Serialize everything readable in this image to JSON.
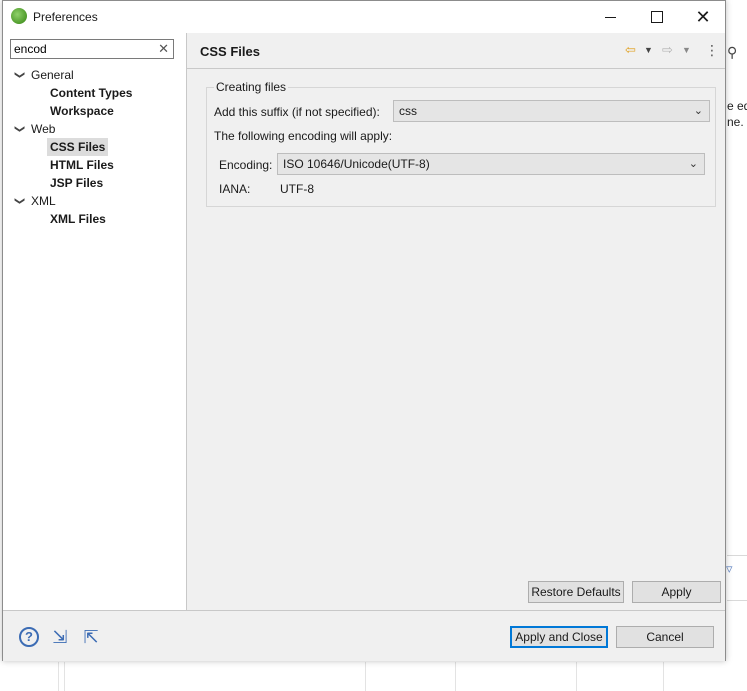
{
  "window": {
    "title": "Preferences"
  },
  "filter": {
    "value": "encod"
  },
  "tree": {
    "items": [
      {
        "label": "General",
        "kind": "group"
      },
      {
        "label": "Content Types",
        "kind": "child"
      },
      {
        "label": "Workspace",
        "kind": "child"
      },
      {
        "label": "Web",
        "kind": "group"
      },
      {
        "label": "CSS Files",
        "kind": "child",
        "selected": true
      },
      {
        "label": "HTML Files",
        "kind": "child"
      },
      {
        "label": "JSP Files",
        "kind": "child"
      },
      {
        "label": "XML",
        "kind": "group"
      },
      {
        "label": "XML Files",
        "kind": "child"
      }
    ]
  },
  "page": {
    "title": "CSS Files",
    "group_label": "Creating files",
    "suffix_label": "Add this suffix (if not specified):",
    "suffix_value": "css",
    "encoding_info": "The following encoding will apply:",
    "encoding_label": "Encoding:",
    "encoding_value": "ISO 10646/Unicode(UTF-8)",
    "iana_label": "IANA:",
    "iana_value": "UTF-8",
    "restore_defaults": "Restore Defaults",
    "apply": "Apply"
  },
  "footer": {
    "apply_and_close": "Apply and Close",
    "cancel": "Cancel"
  },
  "background": {
    "text_1": "e ed",
    "text_2": "ne."
  },
  "colors": {
    "accent": "#0078d7",
    "icon_blue": "#3c6cb4",
    "back_arrow": "#e0a020"
  }
}
